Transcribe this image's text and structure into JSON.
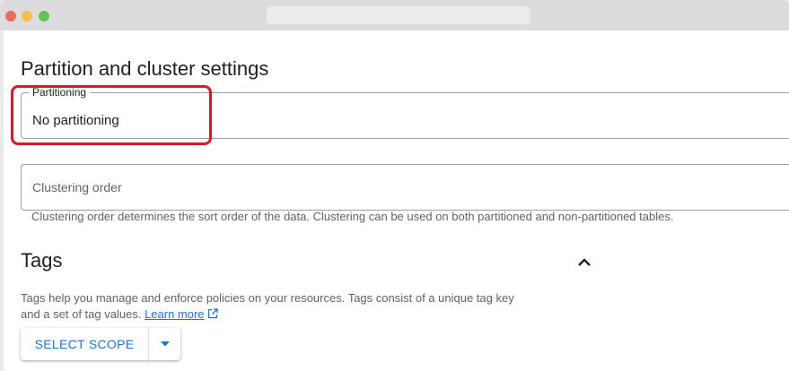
{
  "partition": {
    "section_title": "Partition and cluster settings",
    "partitioning_label": "Partitioning",
    "partitioning_value": "No partitioning"
  },
  "clustering": {
    "placeholder": "Clustering order",
    "hint": "Clustering order determines the sort order of the data. Clustering can be used on both partitioned and non-partitioned tables."
  },
  "tags": {
    "title": "Tags",
    "description_line1": "Tags help you manage and enforce policies on your resources. Tags consist of a unique tag key",
    "description_line2": "and a set of tag values.",
    "learn_more": "Learn more",
    "select_scope": "SELECT SCOPE"
  },
  "colors": {
    "accent": "#1a73e8",
    "highlight": "#d81b22"
  },
  "icons": {
    "collapse": "chevron-up-icon",
    "external": "external-link-icon",
    "dropdown": "caret-down-icon"
  }
}
